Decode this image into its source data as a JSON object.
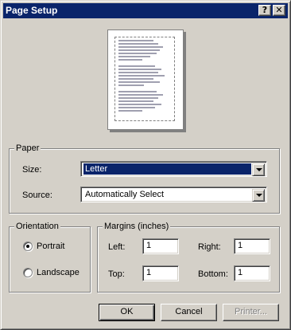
{
  "window": {
    "title": "Page Setup",
    "help_label": "?",
    "close_label": "✕"
  },
  "paper": {
    "group_label": "Paper",
    "size_label": "Size:",
    "size_value": "Letter",
    "source_label": "Source:",
    "source_value": "Automatically Select"
  },
  "orientation": {
    "group_label": "Orientation",
    "portrait_label": "Portrait",
    "landscape_label": "Landscape",
    "selected": "Portrait"
  },
  "margins": {
    "group_label": "Margins (inches)",
    "left_label": "Left:",
    "left_value": "1",
    "right_label": "Right:",
    "right_value": "1",
    "top_label": "Top:",
    "top_value": "1",
    "bottom_label": "Bottom:",
    "bottom_value": "1"
  },
  "buttons": {
    "ok": "OK",
    "cancel": "Cancel",
    "printer": "Printer..."
  },
  "colors": {
    "dialog_bg": "#d4d0c8",
    "title_bar": "#0a246a",
    "selection": "#0a246a"
  }
}
